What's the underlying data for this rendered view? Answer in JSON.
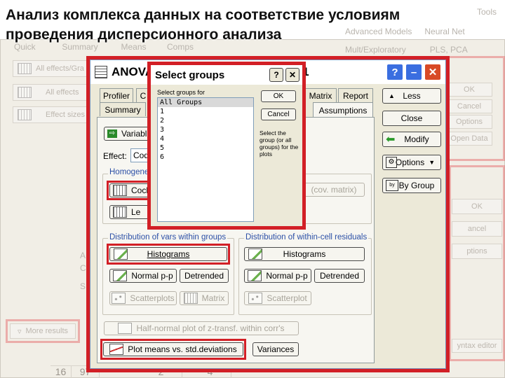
{
  "slide_title": "Анализ комплекса данных на соответствие условиям\nпроведения дисперсионного анализа",
  "background": {
    "left_tabs": [
      "Quick",
      "Summary",
      "Means",
      "Comps"
    ],
    "left_buttons": [
      "All effects/Gra",
      "All effects",
      "Effect sizes"
    ],
    "more_results": "More results",
    "right_top_items": [
      "Advanced Models",
      "Neural Net",
      "Mult/Exploratory",
      "PLS, PCA"
    ],
    "right_top_title": "Tools",
    "right_buttons": [
      "OK",
      "Cancel",
      "Options",
      "Open Data"
    ],
    "right_lower_buttons": [
      "OK",
      "ancel",
      "ptions"
    ],
    "syntax_editor": "yntax editor",
    "grid_numbers": [
      "16",
      "97"
    ],
    "grid_bottom": [
      "2",
      "4"
    ],
    "side_letters": [
      "A",
      "C",
      "S"
    ]
  },
  "dialog": {
    "title": "ANOVA",
    "title_suffix": "1",
    "tabs_row1": [
      "Profiler",
      "C",
      "Matrix",
      "Report"
    ],
    "tabs_row2": [
      "Summary",
      "Assumptions"
    ],
    "variables_btn": "Variable",
    "effect_label": "Effect:",
    "effect_value": "Cod",
    "homogeneity_label": "Homogene",
    "cochran_btn": "Coch",
    "levene_btn": "Le",
    "cov_matrix_btn": "(cov. matrix)",
    "dist_vars_label": "Distribution of vars within groups",
    "dist_resid_label": "Distribution of within-cell residuals",
    "histograms": "Histograms",
    "histograms2": "Histograms",
    "normal_pp": "Normal p-p",
    "normal_pp2": "Normal p-p",
    "detrended": "Detrended",
    "detrended2": "Detrended",
    "scatterplots": "Scatterplots",
    "matrix": "Matrix",
    "scatterplot": "Scatterplot",
    "half_normal": "Half-normal plot of z-transf. within corr's",
    "plot_means": "Plot means vs. std.deviations",
    "variances": "Variances",
    "side_buttons": {
      "less": "Less",
      "close": "Close",
      "modify": "Modify",
      "options": "Options",
      "by_group": "By Group"
    }
  },
  "select_groups": {
    "title": "Select groups",
    "list_caption": "Select groups for",
    "items": [
      "All Groups",
      "1",
      "2",
      "3",
      "4",
      "5",
      "6"
    ],
    "ok": "OK",
    "cancel": "Cancel",
    "help": "Select the group (or all groups) for the plots"
  },
  "colors": {
    "highlight_red": "#d21f26",
    "xp_blue": "#3a6ee0",
    "xp_close": "#d84a26"
  }
}
